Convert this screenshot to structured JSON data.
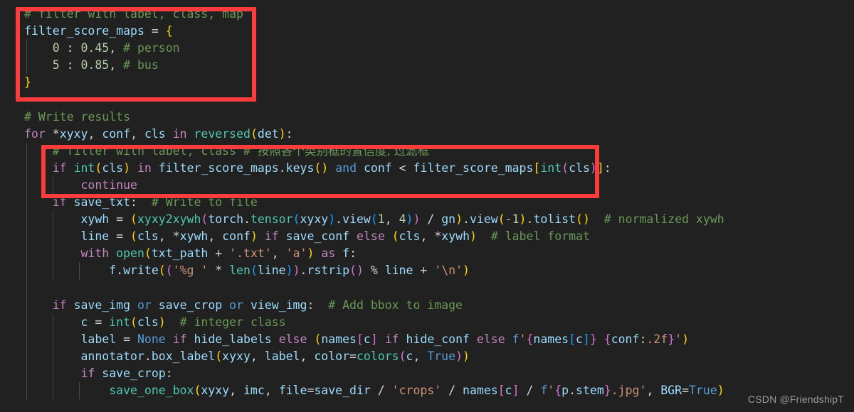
{
  "editor": {
    "theme_background": "#212121",
    "font_size_px": 16.5,
    "language": "python",
    "indent_guide_color": "#4a4a4a"
  },
  "colors": {
    "comment": "#6A9955",
    "keyword": "#C586C0",
    "keyword_builtin": "#569CD6",
    "variable": "#9CDCFE",
    "function": "#4EC9B0",
    "number": "#B5CEA8",
    "string": "#CE9178",
    "bracket_yellow": "#FFD700",
    "bracket_magenta": "#DA70D6",
    "bracket_blue": "#179FFF",
    "highlight_box": "#FA3C3C"
  },
  "code": {
    "lines": [
      "# filter with label, class, map",
      "filter_score_maps = {",
      "    0 : 0.45, # person",
      "    5 : 0.85, # bus",
      "}",
      "",
      "# Write results",
      "for *xyxy, conf, cls in reversed(det):",
      "    # filter with label, class # 按照各个类别框的置信度, 过滤框",
      "    if int(cls) in filter_score_maps.keys() and conf < filter_score_maps[int(cls)]:",
      "        continue",
      "    if save_txt:  # Write to file",
      "        xywh = (xyxy2xywh(torch.tensor(xyxy).view(1, 4)) / gn).view(-1).tolist()  # normalized xywh",
      "        line = (cls, *xywh, conf) if save_conf else (cls, *xywh)  # label format",
      "        with open(txt_path + '.txt', 'a') as f:",
      "            f.write(('%g ' * len(line)).rstrip() % line + '\\n')",
      "",
      "    if save_img or save_crop or view_img:  # Add bbox to image",
      "        c = int(cls)  # integer class",
      "        label = None if hide_labels else (names[c] if hide_conf else f'{names[c]} {conf:.2f}')",
      "        annotator.box_label(xyxy, label, color=colors(c, True))",
      "        if save_crop:",
      "            save_one_box(xyxy, imc, file=save_dir / 'crops' / names[c] / f'{p.stem}.jpg', BGR=True)"
    ]
  },
  "highlights": [
    {
      "name": "filter-score-map-box",
      "label": "filter_score_maps dict definition",
      "color": "#FA3C3C"
    },
    {
      "name": "filter-condition-box",
      "label": "confidence filter condition",
      "color": "#FA3C3C"
    }
  ],
  "watermark": {
    "text": "CSDN @FriendshipT"
  }
}
